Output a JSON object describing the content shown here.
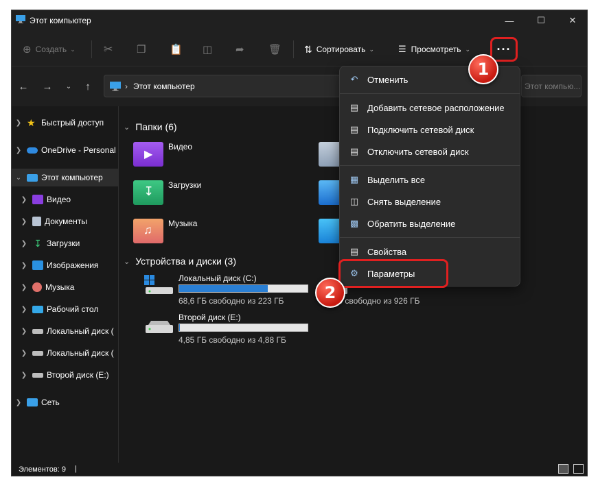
{
  "window": {
    "title": "Этот компьютер"
  },
  "toolbar": {
    "create_label": "Создать",
    "sort_label": "Сортировать",
    "view_label": "Просмотреть",
    "more_label": "···"
  },
  "navbar": {
    "address": "Этот компьютер",
    "search_placeholder": "Этот компью..."
  },
  "sidebar": {
    "items": [
      {
        "label": "Быстрый доступ"
      },
      {
        "label": "OneDrive - Personal"
      },
      {
        "label": "Этот компьютер"
      },
      {
        "label": "Видео"
      },
      {
        "label": "Документы"
      },
      {
        "label": "Загрузки"
      },
      {
        "label": "Изображения"
      },
      {
        "label": "Музыка"
      },
      {
        "label": "Рабочий стол"
      },
      {
        "label": "Локальный диск ("
      },
      {
        "label": "Локальный диск ("
      },
      {
        "label": "Второй диск (E:)"
      },
      {
        "label": "Сеть"
      }
    ]
  },
  "content": {
    "folders_header": "Папки (6)",
    "folders": [
      {
        "label": "Видео"
      },
      {
        "label": "Загрузки"
      },
      {
        "label": "Музыка"
      }
    ],
    "drives_header": "Устройства и диски (3)",
    "drives": [
      {
        "name": "Локальный диск (C:)",
        "free": "68,6 ГБ свободно из 223 ГБ",
        "used_fraction": 0.69
      },
      {
        "name": "Второй диск (E:)",
        "free": "4,85 ГБ свободно из 4,88 ГБ",
        "used_fraction": 0.006
      }
    ],
    "partial_drive_free": "44 ГБ свободно из 926 ГБ"
  },
  "menu": {
    "items": [
      {
        "label": "Отменить",
        "icon": "undo-icon"
      },
      {
        "label": "Добавить сетевое расположение",
        "icon": "network-location-icon"
      },
      {
        "label": "Подключить сетевой диск",
        "icon": "map-drive-icon"
      },
      {
        "label": "Отключить сетевой диск",
        "icon": "disconnect-drive-icon"
      },
      {
        "label": "Выделить все",
        "icon": "select-all-icon"
      },
      {
        "label": "Снять выделение",
        "icon": "select-none-icon"
      },
      {
        "label": "Обратить выделение",
        "icon": "invert-selection-icon"
      },
      {
        "label": "Свойства",
        "icon": "properties-icon"
      },
      {
        "label": "Параметры",
        "icon": "options-icon"
      }
    ]
  },
  "status": {
    "items_count": "Элементов: 9"
  },
  "annotations": {
    "badge1": "1",
    "badge2": "2"
  },
  "colors": {
    "highlight": "#e02020",
    "accent": "#2a7fd4",
    "background": "#191919"
  }
}
